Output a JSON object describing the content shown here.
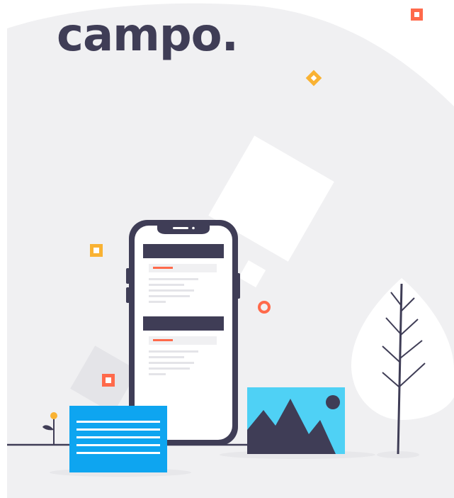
{
  "brand": {
    "wordmark": "campo."
  },
  "colors": {
    "background_blob": "#f0f0f2",
    "ink": "#3f3d56",
    "accent_orange": "#ff6a4b",
    "accent_yellow": "#f9b233",
    "accent_blue": "#0ea5f0",
    "accent_light_blue": "#4fd1f5",
    "white": "#ffffff"
  },
  "icons": [
    "phone-icon",
    "document-card-icon",
    "mountain-image-icon",
    "tree-icon",
    "flower-icon",
    "confetti-square-icon",
    "confetti-diamond-icon",
    "confetti-ring-icon"
  ]
}
